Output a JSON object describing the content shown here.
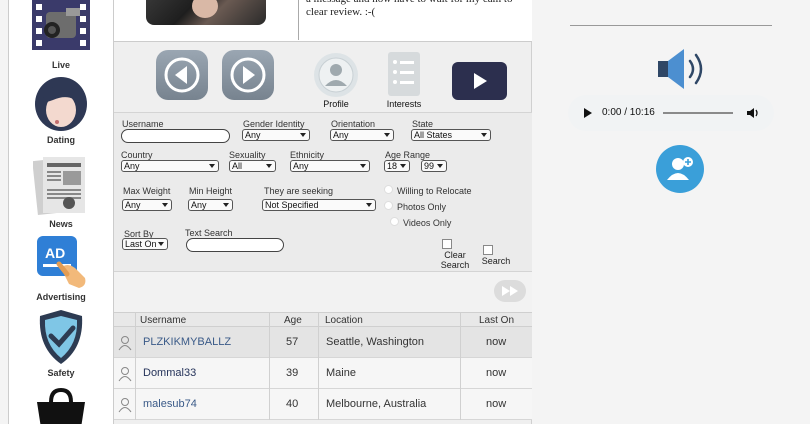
{
  "sidebar": {
    "items": [
      {
        "label": "Live",
        "icon": "video-camera-icon"
      },
      {
        "label": "Dating",
        "icon": "woman-face-icon"
      },
      {
        "label": "News",
        "icon": "newspaper-icon"
      },
      {
        "label": "Advertising",
        "icon": "ad-hand-icon"
      },
      {
        "label": "Safety",
        "icon": "shield-check-icon"
      },
      {
        "label": "",
        "icon": "shopping-bag-icon"
      }
    ]
  },
  "profile": {
    "message_text": "a message and now have to wait for my cam to clear review.  :-("
  },
  "nav": {
    "profile_label": "Profile",
    "interests_label": "Interests"
  },
  "search": {
    "username_label": "Username",
    "username_value": "",
    "gender_label": "Gender Identity",
    "gender_value": "Any",
    "orientation_label": "Orientation",
    "orientation_value": "Any",
    "state_label": "State",
    "state_value": "All States",
    "country_label": "Country",
    "country_value": "Any",
    "sexuality_label": "Sexuality",
    "sexuality_value": "All",
    "ethnicity_label": "Ethnicity",
    "ethnicity_value": "Any",
    "age_range_label": "Age Range",
    "age_min_value": "18",
    "age_max_value": "99",
    "max_weight_label": "Max Weight",
    "max_weight_value": "Any",
    "min_height_label": "Min Height",
    "min_height_value": "Any",
    "seeking_label": "They are seeking",
    "seeking_value": "Not Specified",
    "relocate_label": "Willing to Relocate",
    "photos_only_label": "Photos Only",
    "videos_only_label": "Videos Only",
    "sort_by_label": "Sort By",
    "sort_by_value": "Last On",
    "text_search_label": "Text Search",
    "text_search_value": "",
    "clear_label_1": "Clear",
    "clear_label_2": "Search",
    "search_label": "Search"
  },
  "results": {
    "columns": [
      "Username",
      "Age",
      "Location",
      "Last On"
    ],
    "rows": [
      {
        "username": "PLZKIKMYBALLZ",
        "age": "57",
        "location": "Seattle, Washington",
        "last_on": "now"
      },
      {
        "username": "Dommal33",
        "age": "39",
        "location": "Maine",
        "last_on": "now"
      },
      {
        "username": "malesub74",
        "age": "40",
        "location": "Melbourne, Australia",
        "last_on": "now"
      }
    ]
  },
  "audio": {
    "time": "0:00 / 10:16",
    "progress": 0
  },
  "colors": {
    "accent_blue": "#3a9fd9",
    "link_blue": "#3a5a88",
    "video_button": "#2c2f4e"
  }
}
